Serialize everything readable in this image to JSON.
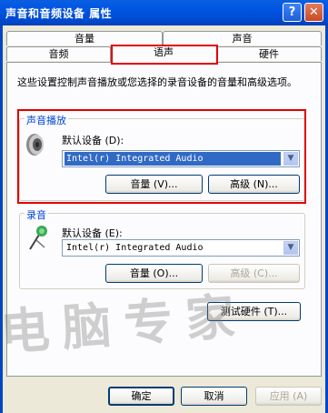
{
  "window": {
    "title": "声音和音频设备 属性",
    "help_glyph": "?",
    "close_glyph": "✕"
  },
  "tabs": {
    "row_back": [
      "音量",
      "声音"
    ],
    "row_front": [
      "音频",
      "语声",
      "硬件"
    ],
    "selected": "语声"
  },
  "description": "这些设置控制声音播放或您选择的录音设备的音量和高级选项。",
  "playback": {
    "group_title": "声音播放",
    "device_label": "默认设备 (D):",
    "device_value": "Intel(r) Integrated Audio",
    "volume_button": "音量 (V)...",
    "advanced_button": "高级 (N)..."
  },
  "recording": {
    "group_title": "录音",
    "device_label": "默认设备 (E):",
    "device_value": "Intel(r) Integrated Audio",
    "volume_button": "音量 (O)...",
    "advanced_button": "高级 (C)..."
  },
  "test_hardware_button": "测试硬件 (T)...",
  "footer": {
    "ok": "确定",
    "cancel": "取消",
    "apply": "应用 (A)"
  },
  "watermark": "电脑专家",
  "colors": {
    "titlebar": "#0054E3",
    "highlight": "#316AC5",
    "annotation_red": "#E00000",
    "group_title": "#0046D5"
  }
}
